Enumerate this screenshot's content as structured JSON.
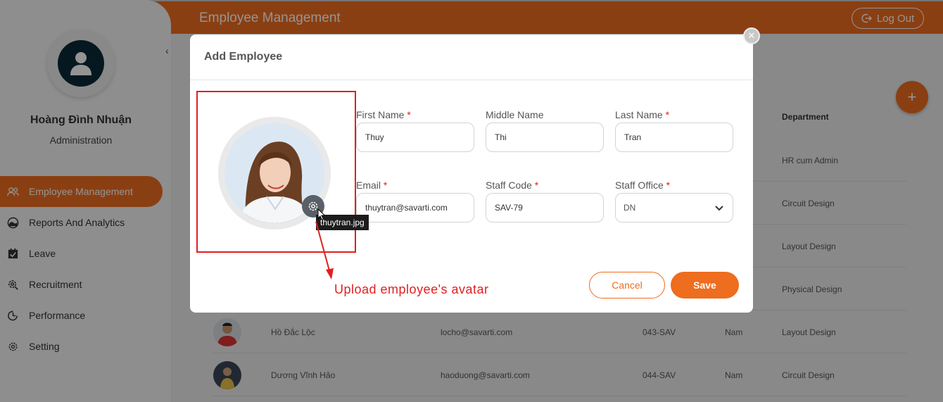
{
  "header": {
    "title": "Employee Management",
    "logout_label": "Log Out"
  },
  "sidebar": {
    "user_name": "Hoàng Đình Nhuận",
    "user_role": "Administration",
    "items": [
      {
        "label": "Employee Management",
        "icon": "people-icon",
        "active": true
      },
      {
        "label": "Reports And Analytics",
        "icon": "gauge-icon",
        "active": false
      },
      {
        "label": "Leave",
        "icon": "calendar-check-icon",
        "active": false
      },
      {
        "label": "Recruitment",
        "icon": "recruit-gear-icon",
        "active": false
      },
      {
        "label": "Performance",
        "icon": "performance-icon",
        "active": false
      },
      {
        "label": "Setting",
        "icon": "gear-icon",
        "active": false
      }
    ]
  },
  "table": {
    "department_header": "Department",
    "rows": [
      {
        "name": "",
        "email": "",
        "code": "",
        "gender": "",
        "department": "HR cum Admin"
      },
      {
        "name": "",
        "email": "",
        "code": "",
        "gender": "",
        "department": "Circuit Design"
      },
      {
        "name": "",
        "email": "",
        "code": "",
        "gender": "",
        "department": "Layout Design"
      },
      {
        "name": "",
        "email": "",
        "code": "",
        "gender": "",
        "department": "Physical Design"
      },
      {
        "name": "Hồ Đắc Lộc",
        "email": "locho@savarti.com",
        "code": "043-SAV",
        "gender": "Nam",
        "department": "Layout Design"
      },
      {
        "name": "Dương Vĩnh Hảo",
        "email": "haoduong@savarti.com",
        "code": "044-SAV",
        "gender": "Nam",
        "department": "Circuit Design"
      }
    ]
  },
  "modal": {
    "title": "Add Employee",
    "avatar_filename_tooltip": "thuytran.jpg",
    "fields": {
      "first_name": {
        "label": "First Name",
        "required": "*",
        "value": "Thuy"
      },
      "middle_name": {
        "label": "Middle Name",
        "value": "Thi"
      },
      "last_name": {
        "label": "Last Name",
        "required": "*",
        "value": "Tran"
      },
      "email": {
        "label": "Email",
        "required": "*",
        "value": "thuytran@savarti.com"
      },
      "staff_code": {
        "label": "Staff Code",
        "required": "*",
        "value": "SAV-79"
      },
      "staff_office": {
        "label": "Staff Office",
        "required": "*",
        "value": "DN"
      }
    },
    "cancel_label": "Cancel",
    "save_label": "Save"
  },
  "annotation": {
    "text": "Upload employee's avatar",
    "color": "#e02020"
  },
  "colors": {
    "accent": "#ee6d1f"
  }
}
